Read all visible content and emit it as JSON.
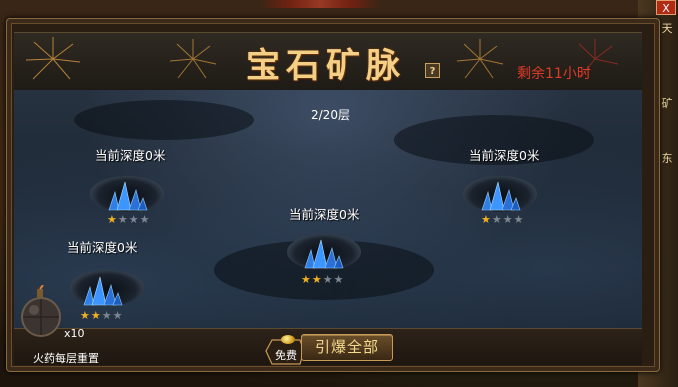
{
  "window": {
    "title": "宝石矿脉",
    "remaining_time": "剩余11小时",
    "help_label": "?",
    "close_label": "X"
  },
  "floor_indicator": "2/20层",
  "mines": [
    {
      "depth_label": "当前深度0米",
      "stars_filled": 1,
      "stars_total": 4
    },
    {
      "depth_label": "当前深度0米",
      "stars_filled": 1,
      "stars_total": 4
    },
    {
      "depth_label": "当前深度0米",
      "stars_filled": 2,
      "stars_total": 4
    },
    {
      "depth_label": "当前深度0米",
      "stars_filled": 2,
      "stars_total": 4
    }
  ],
  "bomb": {
    "count": "x10",
    "reset_label": "火药每层重置"
  },
  "actions": {
    "free_label": "免费",
    "detonate_all_label": "引爆全部"
  },
  "background_side_text": [
    "天",
    "矿",
    "东"
  ],
  "colors": {
    "title": "#f4cf86",
    "remaining": "#e03a28",
    "star_on": "#f0b020",
    "star_off": "#7d8590",
    "crystal": "#2f7fe6",
    "border_gold": "#c89a58"
  }
}
